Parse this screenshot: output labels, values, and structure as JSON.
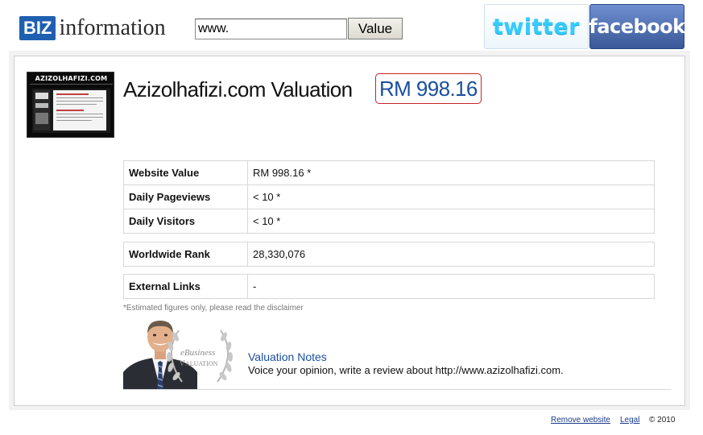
{
  "header": {
    "logo_badge": "BIZ",
    "logo_word": "information",
    "search_value": "www.",
    "value_button": "Value",
    "twitter": "twitter",
    "facebook": "facebook"
  },
  "thumbnail": {
    "caption": "AZIZOLHAFIZI.COM"
  },
  "valuation": {
    "title": "Azizolhafizi.com Valuation",
    "amount": "RM 998.16"
  },
  "stats": {
    "group1": [
      {
        "label": "Website Value",
        "value": "RM 998.16 *"
      },
      {
        "label": "Daily Pageviews",
        "value": "< 10 *"
      },
      {
        "label": "Daily Visitors",
        "value": "< 10 *"
      }
    ],
    "group2": [
      {
        "label": "Worldwide Rank",
        "value": "28,330,076"
      }
    ],
    "group3": [
      {
        "label": "External Links",
        "value": "-"
      }
    ]
  },
  "disclaimer": "*Estimated figures only, please read the disclaimer",
  "promo": {
    "badge_line1": "eBusiness",
    "badge_line2": "Valuation",
    "notes_title": "Valuation Notes",
    "notes_text": "Voice your opinion, write a review about http://www.azizolhafizi.com."
  },
  "footer": {
    "remove": "Remove website",
    "legal": "Legal",
    "copyright": "© 2010"
  },
  "colors": {
    "brand_blue": "#1f5fb0",
    "link_blue": "#1a4fa0",
    "highlight_border": "#c8202a",
    "twitter": "#33ccff",
    "facebook": "#3b5998"
  }
}
